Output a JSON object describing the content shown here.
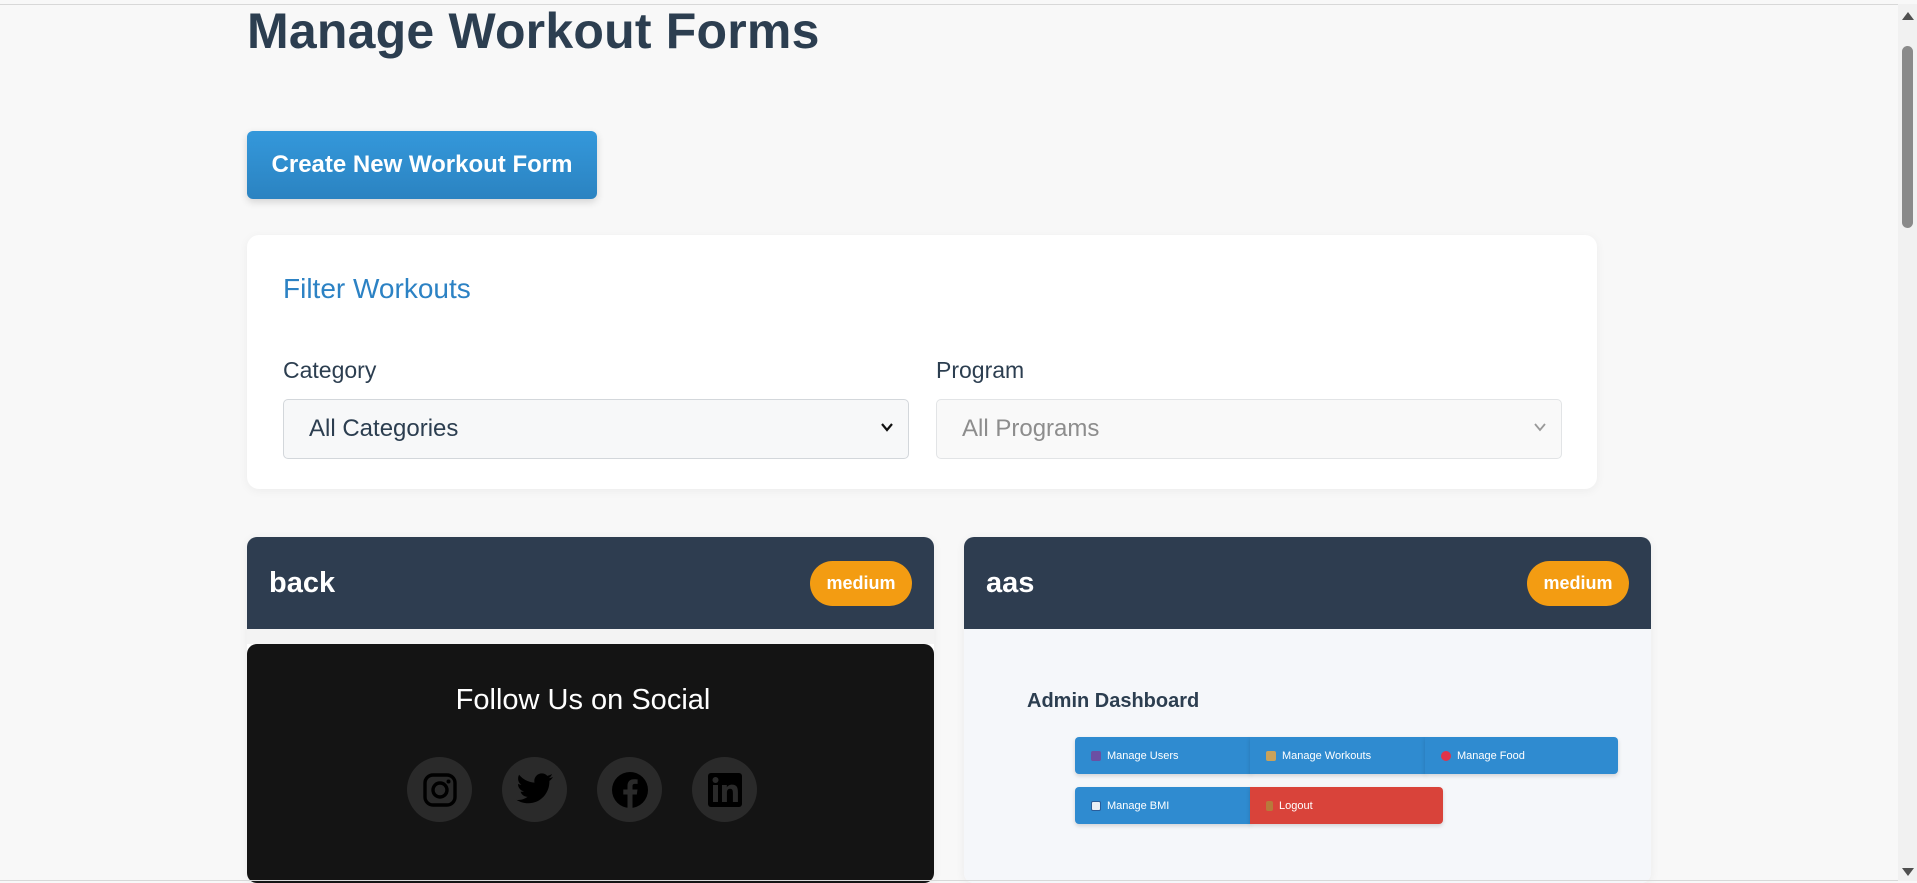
{
  "page": {
    "title": "Manage Workout Forms"
  },
  "actions": {
    "create_label": "Create New Workout Form"
  },
  "filter": {
    "title": "Filter Workouts",
    "category": {
      "label": "Category",
      "value": "All Categories"
    },
    "program": {
      "label": "Program",
      "value": "All Programs",
      "disabled": true
    }
  },
  "workouts": [
    {
      "title": "back",
      "difficulty": "medium",
      "preview": {
        "heading": "Follow Us on Social",
        "icons": [
          "instagram-icon",
          "twitter-icon",
          "facebook-icon",
          "linkedin-icon"
        ]
      }
    },
    {
      "title": "aas",
      "difficulty": "medium",
      "preview": {
        "heading": "Admin Dashboard",
        "buttons": [
          "Manage Users",
          "Manage Workouts",
          "Manage Food",
          "Manage BMI",
          "Logout"
        ]
      }
    }
  ],
  "colors": {
    "primary": "#3498db",
    "dark_header": "#2e3d50",
    "badge": "#f39c12",
    "danger": "#d9433a",
    "title": "#2c3e50"
  }
}
